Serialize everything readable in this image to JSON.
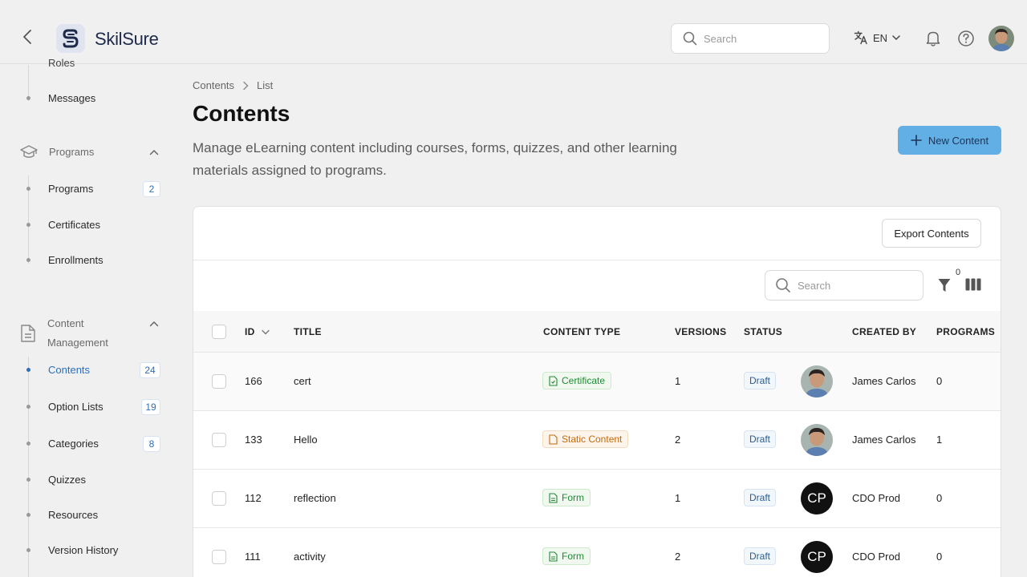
{
  "header": {
    "logo_text": "SkilSure",
    "search_placeholder": "Search",
    "language": "EN"
  },
  "sidebar": {
    "partial_item": "Roles",
    "messages": "Messages",
    "programs_section": "Programs",
    "programs_items": [
      {
        "label": "Programs",
        "badge": "2"
      },
      {
        "label": "Certificates"
      },
      {
        "label": "Enrollments"
      }
    ],
    "content_section": "Content Management",
    "content_items": [
      {
        "label": "Contents",
        "badge": "24",
        "active": true
      },
      {
        "label": "Option Lists",
        "badge": "19"
      },
      {
        "label": "Categories",
        "badge": "8"
      },
      {
        "label": "Quizzes"
      },
      {
        "label": "Resources"
      },
      {
        "label": "Version History"
      }
    ]
  },
  "main": {
    "breadcrumb": [
      "Contents",
      "List"
    ],
    "title": "Contents",
    "description": "Manage eLearning content including courses, forms, quizzes, and other learning materials assigned to programs.",
    "new_button": "New Content",
    "export_button": "Export Contents",
    "table_search_placeholder": "Search",
    "filter_count": "0",
    "columns": {
      "id": "ID",
      "title": "TITLE",
      "content_type": "CONTENT TYPE",
      "versions": "VERSIONS",
      "status": "STATUS",
      "created_by": "CREATED BY",
      "programs": "PROGRAMS"
    },
    "rows": [
      {
        "id": "166",
        "title": "cert",
        "type": "Certificate",
        "type_color": "green",
        "versions": "1",
        "status": "Draft",
        "avatar": "photo",
        "created_by": "James Carlos",
        "programs": "0"
      },
      {
        "id": "133",
        "title": "Hello",
        "type": "Static Content",
        "type_color": "orange",
        "versions": "2",
        "status": "Draft",
        "avatar": "photo",
        "created_by": "James Carlos",
        "programs": "1"
      },
      {
        "id": "112",
        "title": "reflection",
        "type": "Form",
        "type_color": "green",
        "versions": "1",
        "status": "Draft",
        "avatar": "CP",
        "created_by": "CDO Prod",
        "programs": "0"
      },
      {
        "id": "111",
        "title": "activity",
        "type": "Form",
        "type_color": "green",
        "versions": "2",
        "status": "Draft",
        "avatar": "CP",
        "created_by": "CDO Prod",
        "programs": "0"
      }
    ]
  },
  "colors": {
    "accent": "#2c6fbb",
    "primary_button": "#62afe6",
    "green_badge": "#1f8a34",
    "orange_badge": "#c46a0c"
  }
}
